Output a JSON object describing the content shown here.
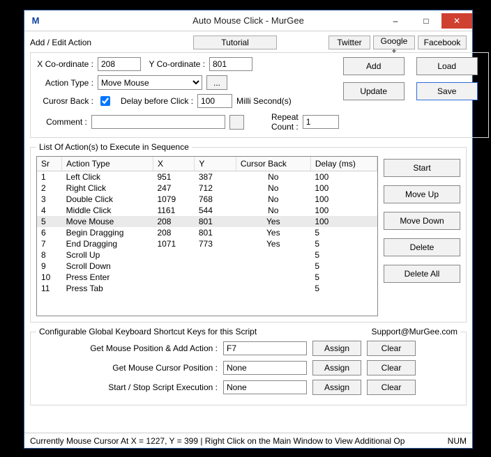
{
  "window": {
    "title": "Auto Mouse Click - MurGee",
    "icon_letter": "M"
  },
  "topbar": {
    "add_edit_label": "Add / Edit Action",
    "tutorial": "Tutorial",
    "twitter": "Twitter",
    "google": "Google +",
    "facebook": "Facebook"
  },
  "addedit": {
    "xcoord_label": "X Co-ordinate :",
    "xcoord_value": "208",
    "ycoord_label": "Y Co-ordinate :",
    "ycoord_value": "801",
    "action_type_label": "Action Type :",
    "action_type_value": "Move Mouse",
    "cursor_back_label": "Curosr Back :",
    "cursor_back_checked": true,
    "delay_label": "Delay before Click :",
    "delay_value": "100",
    "delay_units": "Milli Second(s)",
    "comment_label": "Comment :",
    "comment_value": "",
    "repeat_label": "Repeat Count :",
    "repeat_value": "1",
    "buttons": {
      "add": "Add",
      "load": "Load",
      "update": "Update",
      "save": "Save"
    }
  },
  "list": {
    "legend": "List Of Action(s) to Execute in Sequence",
    "headers": [
      "Sr",
      "Action Type",
      "X",
      "Y",
      "Cursor Back",
      "Delay (ms)"
    ],
    "rows": [
      {
        "sr": "1",
        "type": "Left Click",
        "x": "951",
        "y": "387",
        "cb": "No",
        "d": "100"
      },
      {
        "sr": "2",
        "type": "Right Click",
        "x": "247",
        "y": "712",
        "cb": "No",
        "d": "100"
      },
      {
        "sr": "3",
        "type": "Double Click",
        "x": "1079",
        "y": "768",
        "cb": "No",
        "d": "100"
      },
      {
        "sr": "4",
        "type": "Middle Click",
        "x": "1161",
        "y": "544",
        "cb": "No",
        "d": "100"
      },
      {
        "sr": "5",
        "type": "Move Mouse",
        "x": "208",
        "y": "801",
        "cb": "Yes",
        "d": "100",
        "selected": true
      },
      {
        "sr": "6",
        "type": "Begin Dragging",
        "x": "208",
        "y": "801",
        "cb": "Yes",
        "d": "5"
      },
      {
        "sr": "7",
        "type": "End Dragging",
        "x": "1071",
        "y": "773",
        "cb": "Yes",
        "d": "5"
      },
      {
        "sr": "8",
        "type": "Scroll Up",
        "x": "",
        "y": "",
        "cb": "",
        "d": "5"
      },
      {
        "sr": "9",
        "type": "Scroll Down",
        "x": "",
        "y": "",
        "cb": "",
        "d": "5"
      },
      {
        "sr": "10",
        "type": "Press Enter",
        "x": "",
        "y": "",
        "cb": "",
        "d": "5"
      },
      {
        "sr": "11",
        "type": "Press Tab",
        "x": "",
        "y": "",
        "cb": "",
        "d": "5"
      }
    ],
    "sidebuttons": {
      "start": "Start",
      "moveup": "Move Up",
      "movedown": "Move Down",
      "delete": "Delete",
      "deleteall": "Delete All"
    }
  },
  "shortcuts": {
    "legend": "Configurable Global Keyboard Shortcut Keys for this Script",
    "support": "Support@MurGee.com",
    "rows": [
      {
        "label": "Get Mouse Position & Add Action :",
        "value": "F7"
      },
      {
        "label": "Get Mouse Cursor Position :",
        "value": "None"
      },
      {
        "label": "Start / Stop Script Execution :",
        "value": "None"
      }
    ],
    "assign": "Assign",
    "clear": "Clear"
  },
  "statusbar": {
    "text": "Currently Mouse Cursor At X = 1227, Y = 399 | Right Click on the Main Window to View Additional Op",
    "num": "NUM"
  }
}
